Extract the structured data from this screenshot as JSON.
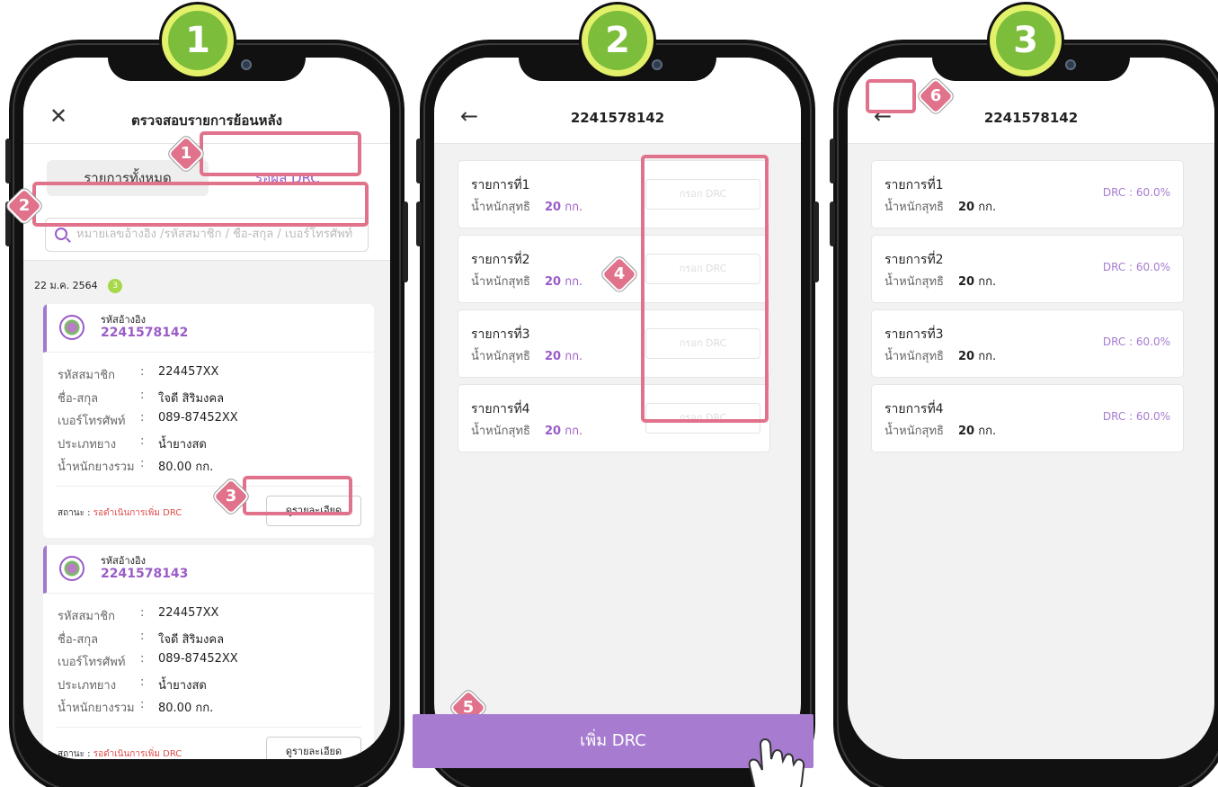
{
  "steps": [
    "1",
    "2",
    "3"
  ],
  "phone1": {
    "title": "ตรวจสอบรายการย้อนหลัง",
    "close_icon": "close-icon",
    "tab_all": "รายการทั้งหมด",
    "tab_drc": "รอผล DRC",
    "search_placeholder": "หมายเลขอ้างอิง /รหัสสมาชิก / ชื่อ-สกุล / เบอร์โทรศัพท์",
    "date": "22 ม.ค. 2564",
    "date_count": "3",
    "records": [
      {
        "ref_label": "รหัสอ้างอิง",
        "ref_no": "2241578142",
        "rows": [
          {
            "k": "รหัสสมาชิก",
            "v": "224457XX"
          },
          {
            "k": "ชื่อ-สกุล",
            "v": "ใจดี สิริมงคล"
          },
          {
            "k": "เบอร์โทรศัพท์",
            "v": "089-87452XX"
          },
          {
            "k": "ประเภทยาง",
            "v": "น้ำยางสด"
          },
          {
            "k": "น้ำหนักยางรวม",
            "v": "80.00 กก."
          }
        ],
        "status_label": "สถานะ : ",
        "status_value": "รอดำเนินการเพิ่ม DRC",
        "detail_button": "ดูรายละเอียด"
      },
      {
        "ref_label": "รหัสอ้างอิง",
        "ref_no": "2241578143",
        "rows": [
          {
            "k": "รหัสสมาชิก",
            "v": "224457XX"
          },
          {
            "k": "ชื่อ-สกุล",
            "v": "ใจดี สิริมงคล"
          },
          {
            "k": "เบอร์โทรศัพท์",
            "v": "089-87452XX"
          },
          {
            "k": "ประเภทยาง",
            "v": "น้ำยางสด"
          },
          {
            "k": "น้ำหนักยางรวม",
            "v": "80.00 กก."
          }
        ],
        "status_label": "สถานะ : ",
        "status_value": "รอดำเนินการเพิ่ม DRC",
        "detail_button": "ดูรายละเอียด"
      }
    ]
  },
  "phone2": {
    "title": "2241578142",
    "back_icon": "back-arrow-icon",
    "items": [
      {
        "label": "รายการที่1",
        "weight_label": "น้ำหนักสุทธิ",
        "weight_num": "20",
        "weight_unit": "กก.",
        "input_placeholder": "กรอก DRC"
      },
      {
        "label": "รายการที่2",
        "weight_label": "น้ำหนักสุทธิ",
        "weight_num": "20",
        "weight_unit": "กก.",
        "input_placeholder": "กรอก DRC"
      },
      {
        "label": "รายการที่3",
        "weight_label": "น้ำหนักสุทธิ",
        "weight_num": "20",
        "weight_unit": "กก.",
        "input_placeholder": "กรอก DRC"
      },
      {
        "label": "รายการที่4",
        "weight_label": "น้ำหนักสุทธิ",
        "weight_num": "20",
        "weight_unit": "กก.",
        "input_placeholder": "กรอก DRC"
      }
    ],
    "add_button": "เพิ่ม DRC"
  },
  "phone3": {
    "title": "2241578142",
    "back_icon": "back-arrow-icon",
    "items": [
      {
        "label": "รายการที่1",
        "weight_label": "น้ำหนักสุทธิ",
        "weight_num": "20",
        "weight_unit": "กก.",
        "drc": "DRC : 60.0%"
      },
      {
        "label": "รายการที่2",
        "weight_label": "น้ำหนักสุทธิ",
        "weight_num": "20",
        "weight_unit": "กก.",
        "drc": "DRC : 60.0%"
      },
      {
        "label": "รายการที่3",
        "weight_label": "น้ำหนักสุทธิ",
        "weight_num": "20",
        "weight_unit": "กก.",
        "drc": "DRC : 60.0%"
      },
      {
        "label": "รายการที่4",
        "weight_label": "น้ำหนักสุทธิ",
        "weight_num": "20",
        "weight_unit": "กก.",
        "drc": "DRC : 60.0%"
      }
    ]
  },
  "markers": [
    "1",
    "2",
    "3",
    "4",
    "5",
    "6"
  ],
  "colors": {
    "accent": "#9b5cc8",
    "button": "#a77cd0",
    "highlight": "#e0728b",
    "step_green": "#7cbd3c",
    "status_red": "#e24b4b"
  }
}
